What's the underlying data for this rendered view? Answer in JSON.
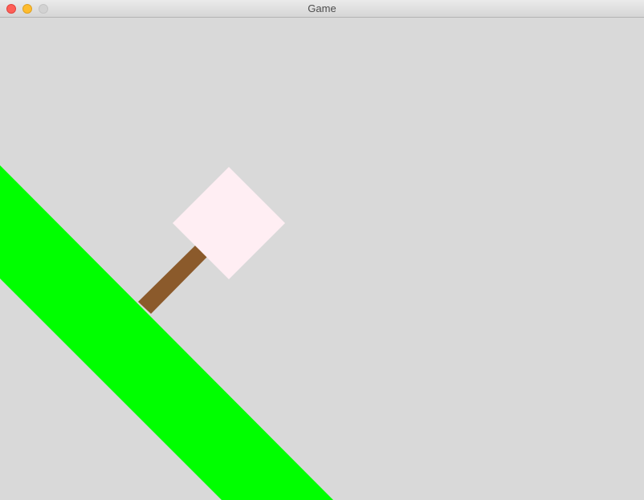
{
  "window": {
    "title": "Game",
    "buttons": {
      "close_color": "#fe5f57",
      "minimize_color": "#febc2e",
      "zoom_color": "#d2d2d2"
    }
  },
  "scene": {
    "background_color": "#d9d9d9",
    "ground": {
      "color": "#00ff00"
    },
    "stick": {
      "color": "#8b5a2b"
    },
    "block": {
      "color": "#ffeef3"
    }
  }
}
